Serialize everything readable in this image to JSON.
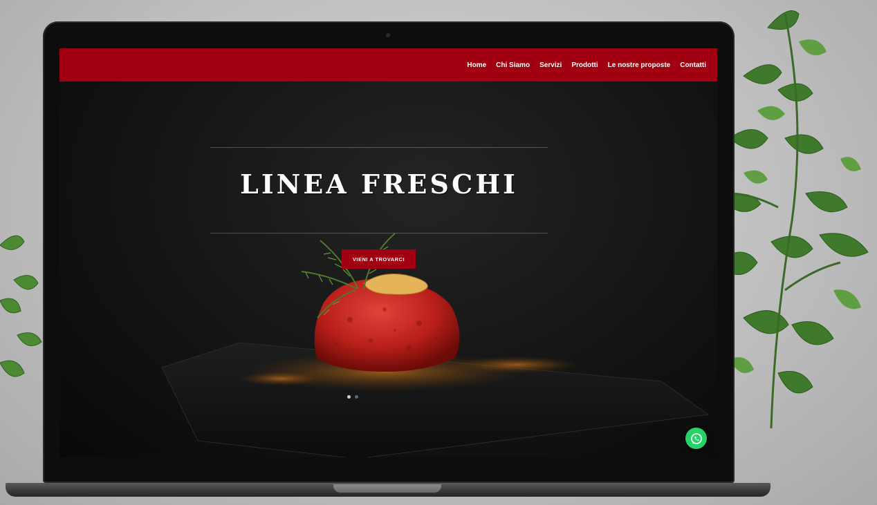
{
  "nav": {
    "items": [
      {
        "label": "Home"
      },
      {
        "label": "Chi Siamo"
      },
      {
        "label": "Servizi"
      },
      {
        "label": "Prodotti"
      },
      {
        "label": "Le nostre proposte"
      },
      {
        "label": "Contatti"
      }
    ]
  },
  "hero": {
    "title": "LINEA FRESCHI",
    "button_label": "VIENI A TROVARCI",
    "slider_dots_count": 2,
    "active_dot": 0
  },
  "floating": {
    "whatsapp_icon": "whatsapp-icon"
  },
  "colors": {
    "brand_red": "#a10010",
    "whatsapp_green": "#25d366"
  }
}
